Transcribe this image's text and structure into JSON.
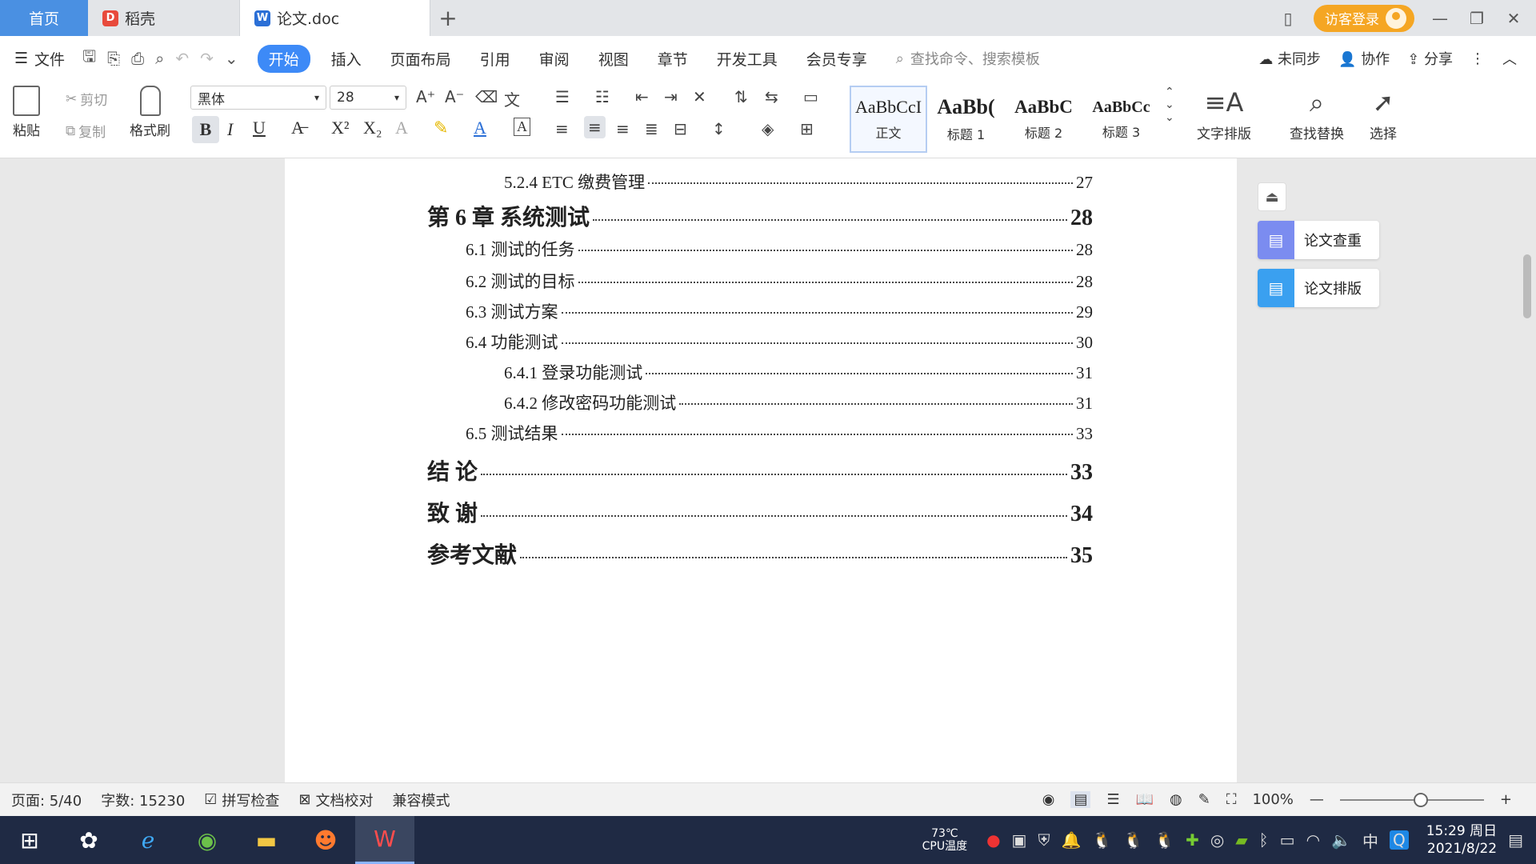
{
  "tabs": {
    "home": "首页",
    "daoke": "稻壳",
    "doc": "论文.doc",
    "add": "+"
  },
  "title_right": {
    "visitor_login": "访客登录"
  },
  "menu": {
    "file": "文件",
    "items": [
      "开始",
      "插入",
      "页面布局",
      "引用",
      "审阅",
      "视图",
      "章节",
      "开发工具",
      "会员专享"
    ],
    "search_placeholder": "查找命令、搜索模板",
    "sync": "未同步",
    "collab": "协作",
    "share": "分享"
  },
  "ribbon": {
    "paste": "粘贴",
    "cut": "剪切",
    "copy": "复制",
    "format_painter": "格式刷",
    "font_name": "黑体",
    "font_size": "28",
    "styles": [
      {
        "sample": "AaBbCcI",
        "name": "正文"
      },
      {
        "sample": "AaBb(",
        "name": "标题 1"
      },
      {
        "sample": "AaBbC",
        "name": "标题 2"
      },
      {
        "sample": "AaBbCc",
        "name": "标题 3"
      }
    ],
    "text_layout": "文字排版",
    "find_replace": "查找替换",
    "select": "选择"
  },
  "toc": [
    {
      "level": 3,
      "text": "5.2.4 ETC 缴费管理",
      "page": "27"
    },
    {
      "level": 1,
      "text": "第 6 章  系统测试",
      "page": "28"
    },
    {
      "level": 2,
      "text": "6.1  测试的任务",
      "page": "28"
    },
    {
      "level": 2,
      "text": "6.2  测试的目标",
      "page": "28"
    },
    {
      "level": 2,
      "text": "6.3  测试方案",
      "page": "29"
    },
    {
      "level": 2,
      "text": "6.4  功能测试",
      "page": "30"
    },
    {
      "level": 3,
      "text": "6.4.1  登录功能测试",
      "page": "31"
    },
    {
      "level": 3,
      "text": "6.4.2  修改密码功能测试",
      "page": "31"
    },
    {
      "level": 2,
      "text": "6.5  测试结果",
      "page": "33"
    },
    {
      "level": 1,
      "text": "结    论",
      "page": "33"
    },
    {
      "level": 1,
      "text": "致    谢",
      "page": "34"
    },
    {
      "level": 1,
      "text": "参考文献",
      "page": "35"
    }
  ],
  "side_panel": {
    "check": "论文查重",
    "format": "论文排版"
  },
  "status": {
    "page": "页面: 5/40",
    "words": "字数: 15230",
    "spell_check": "拼写检查",
    "doc_proof": "文档校对",
    "compat": "兼容模式",
    "zoom": "100%"
  },
  "taskbar": {
    "temp": "73℃",
    "temp_label": "CPU温度",
    "ime": "中",
    "time": "15:29 周日",
    "date": "2021/8/22"
  },
  "colors": {
    "accent": "#3d8af7",
    "visitor": "#f5a623",
    "taskbar": "#1f2a44"
  }
}
